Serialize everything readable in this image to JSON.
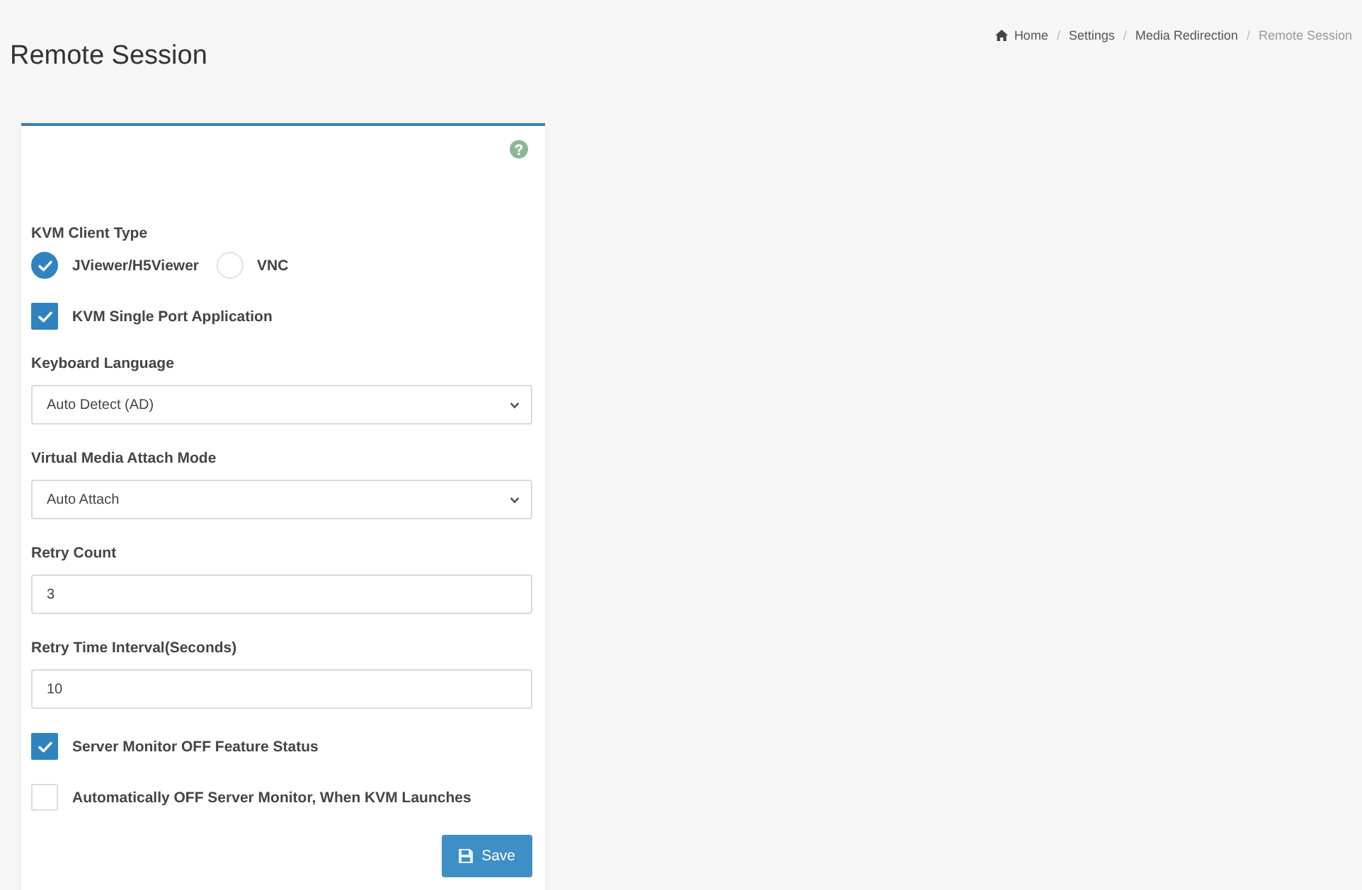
{
  "page": {
    "title": "Remote Session"
  },
  "breadcrumb": {
    "separator": "/",
    "items": [
      {
        "kind": "home",
        "label": "Home"
      },
      {
        "kind": "link",
        "label": "Settings"
      },
      {
        "kind": "link",
        "label": "Media Redirection"
      },
      {
        "kind": "current",
        "label": "Remote Session"
      }
    ]
  },
  "form": {
    "fields": [
      {
        "kind": "radio-group",
        "label": "KVM Client Type",
        "options": [
          {
            "label": "JViewer/H5Viewer",
            "selected": true
          },
          {
            "label": "VNC",
            "selected": false
          }
        ]
      },
      {
        "kind": "checkbox",
        "label": "KVM Single Port Application",
        "checked": true
      },
      {
        "kind": "select",
        "label": "Keyboard Language",
        "value": "Auto Detect (AD)"
      },
      {
        "kind": "select",
        "label": "Virtual Media Attach Mode",
        "value": "Auto Attach"
      },
      {
        "kind": "text",
        "label": "Retry Count",
        "value": "3"
      },
      {
        "kind": "text",
        "label": "Retry Time Interval(Seconds)",
        "value": "10"
      },
      {
        "kind": "checkbox",
        "label": "Server Monitor OFF Feature Status",
        "checked": true
      },
      {
        "kind": "checkbox",
        "label": "Automatically OFF Server Monitor, When KVM Launches",
        "checked": false
      }
    ],
    "buttons": [
      {
        "kind": "save",
        "label": "Save"
      }
    ]
  }
}
